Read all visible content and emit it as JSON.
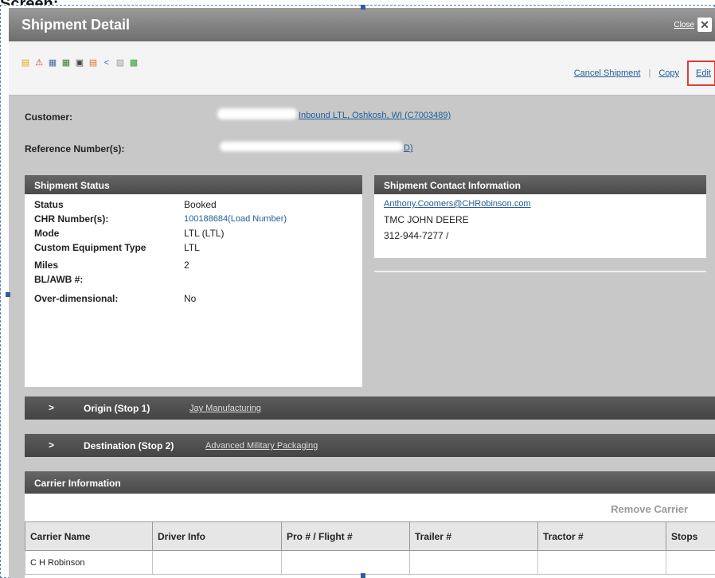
{
  "window": {
    "title": "Shipment Detail",
    "close_label": "Close",
    "close_icon": "✕"
  },
  "toolbar": {
    "icons": [
      {
        "name": "document-icon",
        "glyph": "▤",
        "color": "#e8a317"
      },
      {
        "name": "warning-icon",
        "glyph": "⚠",
        "color": "#d0342c"
      },
      {
        "name": "list-icon",
        "glyph": "▦",
        "color": "#4a6aa8"
      },
      {
        "name": "grid-icon",
        "glyph": "▦",
        "color": "#3a7a3a"
      },
      {
        "name": "report-icon",
        "glyph": "▣",
        "color": "#444444"
      },
      {
        "name": "note-icon",
        "glyph": "▤",
        "color": "#e07020"
      },
      {
        "name": "share-icon",
        "glyph": "<",
        "color": "#3b6fb3"
      },
      {
        "name": "print-icon",
        "glyph": "▨",
        "color": "#9a9a9a"
      },
      {
        "name": "map-icon",
        "glyph": "▩",
        "color": "#3aa03a"
      }
    ],
    "cancel_label": "Cancel Shipment",
    "copy_label": "Copy",
    "edit_label": "Edit",
    "separator": "|"
  },
  "customer": {
    "label": "Customer:",
    "value": "Inbound LTL, Oshkosh, WI (C7003489)"
  },
  "reference": {
    "label": "Reference Number(s):",
    "value": "D)"
  },
  "status_panel": {
    "title": "Shipment Status",
    "rows": [
      {
        "label": "Status",
        "value": "Booked"
      },
      {
        "label": "CHR Number(s):",
        "value": "100188684(Load Number)"
      },
      {
        "label": "Mode",
        "value": "LTL (LTL)"
      },
      {
        "label": "Custom Equipment Type",
        "value": "LTL"
      },
      {
        "label": "Miles",
        "value": "2"
      },
      {
        "label": "BL/AWB #:",
        "value": ""
      },
      {
        "label": "Over-dimensional:",
        "value": "No"
      }
    ]
  },
  "contact_panel": {
    "title": "Shipment Contact Information",
    "email": "Anthony.Coomers@CHRobinson.com",
    "company": "TMC JOHN DEERE",
    "phone": "312-944-7277  /"
  },
  "origin": {
    "chevron": ">",
    "label": "Origin (Stop 1)",
    "location": "Jay Manufacturing"
  },
  "destination": {
    "chevron": ">",
    "label": "Destination (Stop 2)",
    "location": "Advanced Military Packaging"
  },
  "carrier": {
    "title": "Carrier Information",
    "remove_label": "Remove Carrier",
    "columns": [
      "Carrier Name",
      "Driver Info",
      "Pro # / Flight #",
      "Trailer #",
      "Tractor #",
      "Stops"
    ],
    "rows": [
      [
        "C H Robinson",
        "",
        "",
        "",
        "",
        ""
      ]
    ]
  }
}
